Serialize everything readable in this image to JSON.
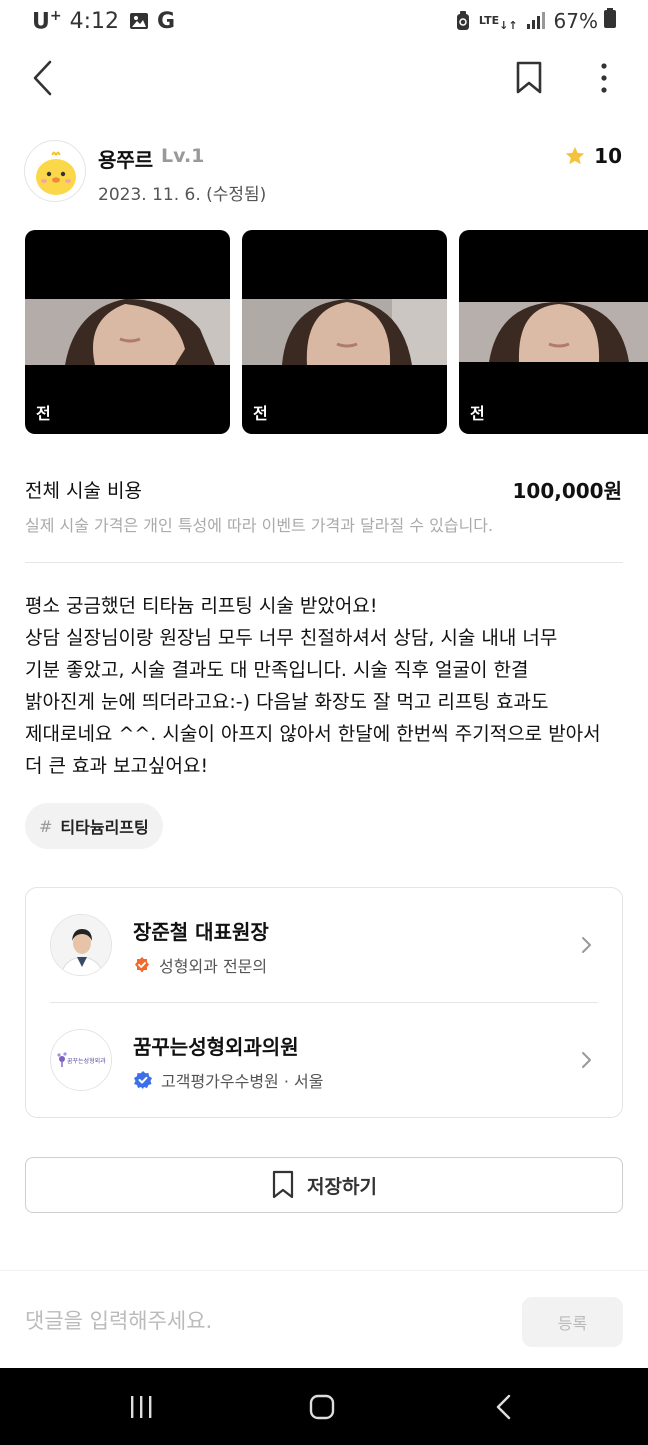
{
  "status_bar": {
    "carrier": "U",
    "carrier_sup": "+",
    "time": "4:12",
    "network": "LTE",
    "battery": "67%"
  },
  "icons": {
    "back": "back-arrow-icon",
    "bookmark": "bookmark-icon",
    "more": "more-vertical-icon",
    "star": "star-icon",
    "verified": "verified-badge-icon",
    "chevron": "chevron-right-icon"
  },
  "review": {
    "author": "용쭈르",
    "level": "Lv.1",
    "date": "2023. 11. 6. (수정됨)",
    "rating": "10",
    "photos": [
      {
        "label": "전"
      },
      {
        "label": "전"
      },
      {
        "label": "전"
      }
    ],
    "cost_label": "전체 시술 비용",
    "cost_value": "100,000원",
    "cost_note": "실제 시술 가격은 개인 특성에 따라 이벤트 가격과 달라질 수 있습니다.",
    "body_lines": [
      "평소 궁금했던 티타늄 리프팅 시술 받았어요!",
      "상담 실장님이랑 원장님 모두 너무 친절하셔서 상담, 시술 내내 너무",
      "기분 좋았고, 시술 결과도 대 만족입니다. 시술 직후 얼굴이 한결",
      "밝아진게 눈에 띄더라고요:-) 다음날 화장도 잘 먹고 리프팅 효과도",
      "제대로네요 ^^. 시술이 아프지 않아서 한달에 한번씩 주기적으로 받아서",
      "더 큰 효과 보고싶어요!"
    ],
    "tag_hash": "#",
    "tag": "티타늄리프팅"
  },
  "doctor": {
    "name": "장준철 대표원장",
    "specialty": "성형외과 전문의"
  },
  "hospital": {
    "name": "꿈꾸는성형외과의원",
    "badge": "고객평가우수병원 · 서울",
    "logo_text": "꿈꾸는성형외과"
  },
  "save_button": {
    "label": "저장하기"
  },
  "comment": {
    "placeholder": "댓글을 입력해주세요.",
    "submit_label": "등록"
  },
  "colors": {
    "star": "#F5C33B",
    "doctor_badge": "#F26A2E",
    "hospital_badge": "#3D6FE8"
  }
}
